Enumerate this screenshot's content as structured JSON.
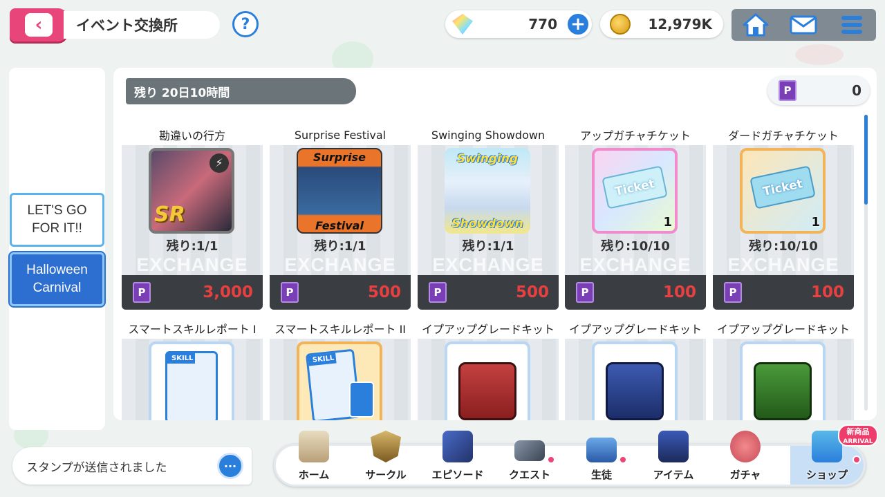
{
  "header": {
    "title": "イベント交換所",
    "help_label": "?",
    "gems": "770",
    "coins": "12,979K",
    "plus_label": "+"
  },
  "events": [
    {
      "label": "LET'S GO FOR IT!!"
    },
    {
      "label": "Halloween Carnival"
    }
  ],
  "exchange": {
    "timer": "残り 20日10時間",
    "points": "0",
    "p_glyph": "P",
    "watermark": "EXCHANGE",
    "items_row1": [
      {
        "name": "勘違いの行方",
        "remain": "残り:1/1",
        "price": "3,000",
        "qty": ""
      },
      {
        "name": "Surprise Festival",
        "remain": "残り:1/1",
        "price": "500",
        "qty": ""
      },
      {
        "name": "Swinging Showdown",
        "remain": "残り:1/1",
        "price": "500",
        "qty": ""
      },
      {
        "name": "アップガチャチケット",
        "remain": "残り:10/10",
        "price": "100",
        "qty": "1"
      },
      {
        "name": "ダードガチャチケット",
        "remain": "残り:10/10",
        "price": "100",
        "qty": "1"
      }
    ],
    "items_row2": [
      {
        "name": "スマートスキルレポート I"
      },
      {
        "name": "スマートスキルレポート II"
      },
      {
        "name": "イプアップグレードキット"
      },
      {
        "name": "イプアップグレードキット"
      },
      {
        "name": "イプアップグレードキット"
      }
    ],
    "thumb_text": {
      "sr": "SR",
      "surprise_top": "Surprise",
      "surprise_bottom": "Festival",
      "swing_top": "Swinging",
      "swing_bottom": "Showdown",
      "ticket": "Ticket",
      "skill": "SKILL"
    }
  },
  "chat": {
    "message": "スタンプが送信されました",
    "icon_glyph": "···"
  },
  "bottom_nav": [
    {
      "label": "ホーム"
    },
    {
      "label": "サークル"
    },
    {
      "label": "エピソード"
    },
    {
      "label": "クエスト"
    },
    {
      "label": "生徒"
    },
    {
      "label": "アイテム"
    },
    {
      "label": "ガチャ"
    },
    {
      "label": "ショップ"
    }
  ],
  "shop_badge": {
    "line1": "新商品",
    "line2": "ARRIVAL"
  },
  "colors": {
    "accent": "#2a7fdc",
    "back": "#e8457a",
    "price": "#e64040",
    "point": "#7a3fb5"
  }
}
